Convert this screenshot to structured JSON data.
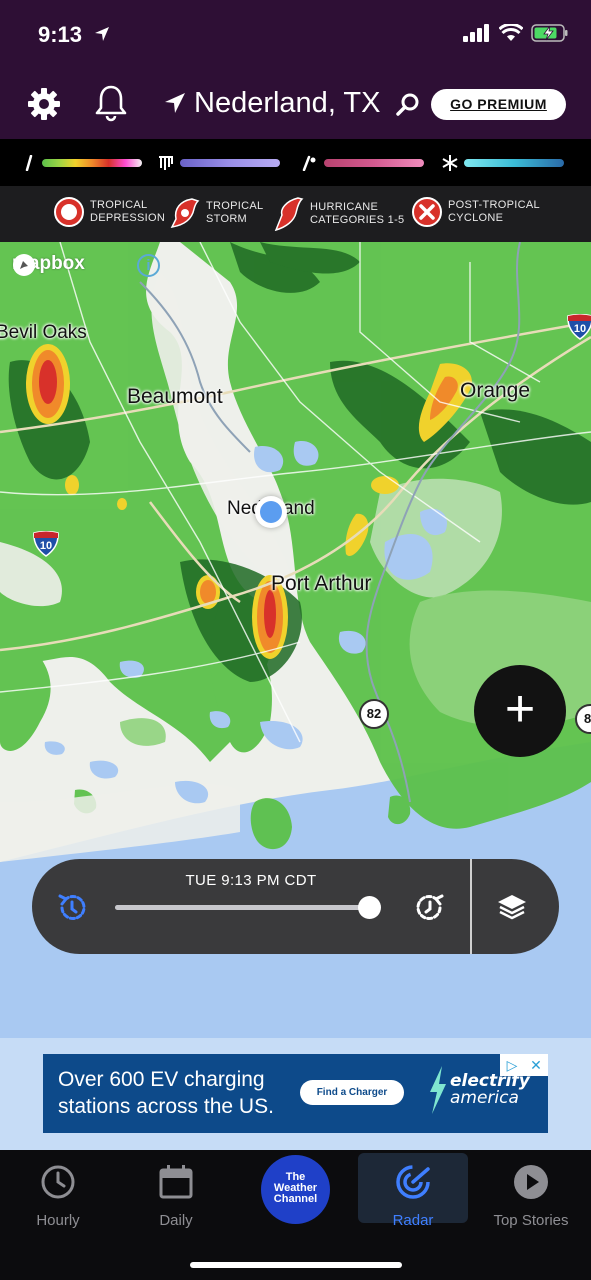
{
  "status_bar": {
    "time": "9:13"
  },
  "header": {
    "location": "Nederland, TX",
    "premium_label": "GO PREMIUM"
  },
  "tropical_legend": [
    {
      "line1": "TROPICAL",
      "line2": "DEPRESSION"
    },
    {
      "line1": "TROPICAL",
      "line2": "STORM"
    },
    {
      "line1": "HURRICANE",
      "line2": "CATEGORIES 1-5"
    },
    {
      "line1": "POST-TROPICAL",
      "line2": "CYCLONE"
    }
  ],
  "map": {
    "attribution": "mapbox",
    "info": "i",
    "cities": {
      "bevil_oaks": "Bevil Oaks",
      "beaumont": "Beaumont",
      "orange": "Orange",
      "nederland": "Nederland",
      "port_arthur": "Port Arthur"
    },
    "interstate_label": "10",
    "route_label": "82",
    "route_label_edge": "8",
    "zoom_in": "+"
  },
  "timeline": {
    "time": "TUE 9:13 PM CDT",
    "progress": 0.96
  },
  "ad": {
    "line1": "Over 600 EV charging",
    "line2": "stations across the US.",
    "cta": "Find a Charger",
    "brand_line1": "electrify",
    "brand_line2": "america"
  },
  "tabs": {
    "hourly": "Hourly",
    "daily": "Daily",
    "logo_line1": "The",
    "logo_line2": "Weather",
    "logo_line3": "Channel",
    "radar": "Radar",
    "top_stories": "Top Stories"
  },
  "colors": {
    "header_bg": "#2e0f35",
    "accent_blue": "#3f7fff",
    "radar_green": "#5cc14a",
    "radar_dark_green": "#1f6a24"
  }
}
